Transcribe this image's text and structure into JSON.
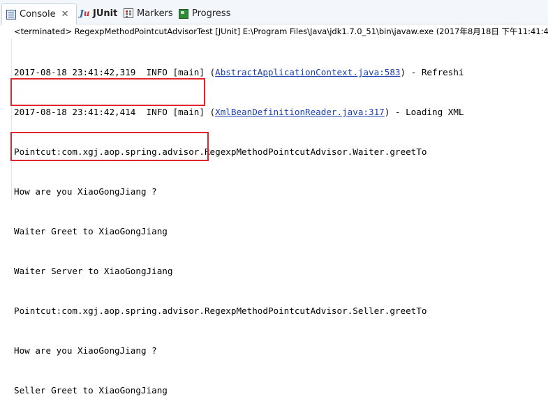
{
  "tabs": [
    {
      "label": "Console",
      "icon": "console-icon",
      "active": true
    },
    {
      "label": "JUnit",
      "icon": "junit-icon"
    },
    {
      "label": "Markers",
      "icon": "markers-icon"
    },
    {
      "label": "Progress",
      "icon": "progress-icon"
    }
  ],
  "close_glyph": "✕",
  "status_text": "<terminated> RegexpMethodPointcutAdvisorTest [JUnit] E:\\Program Files\\Java\\jdk1.7.0_51\\bin\\javaw.exe (2017年8月18日 下午11:41:4",
  "console": {
    "line1": {
      "prefix": "2017-08-18 23:41:42,319  INFO [main] (",
      "link": "AbstractApplicationContext.java:583",
      "suffix": ") - Refreshi"
    },
    "line2": {
      "prefix": "2017-08-18 23:41:42,414  INFO [main] (",
      "link": "XmlBeanDefinitionReader.java:317",
      "suffix": ") - Loading XML"
    },
    "line3": "Pointcut:com.xgj.aop.spring.advisor.RegexpMethodPointcutAdvisor.Waiter.greetTo",
    "line4": "How are you XiaoGongJiang ?",
    "line5": "Waiter Greet to XiaoGongJiang",
    "line6": "Waiter Server to XiaoGongJiang",
    "line7": "Pointcut:com.xgj.aop.spring.advisor.RegexpMethodPointcutAdvisor.Seller.greetTo",
    "line8": "How are you XiaoGongJiang ?",
    "line9": "Seller Greet to XiaoGongJiang"
  },
  "colors": {
    "link": "#1a3fb1",
    "highlight_box": "#e0262c",
    "tab_bar": "#f3f6fa"
  }
}
